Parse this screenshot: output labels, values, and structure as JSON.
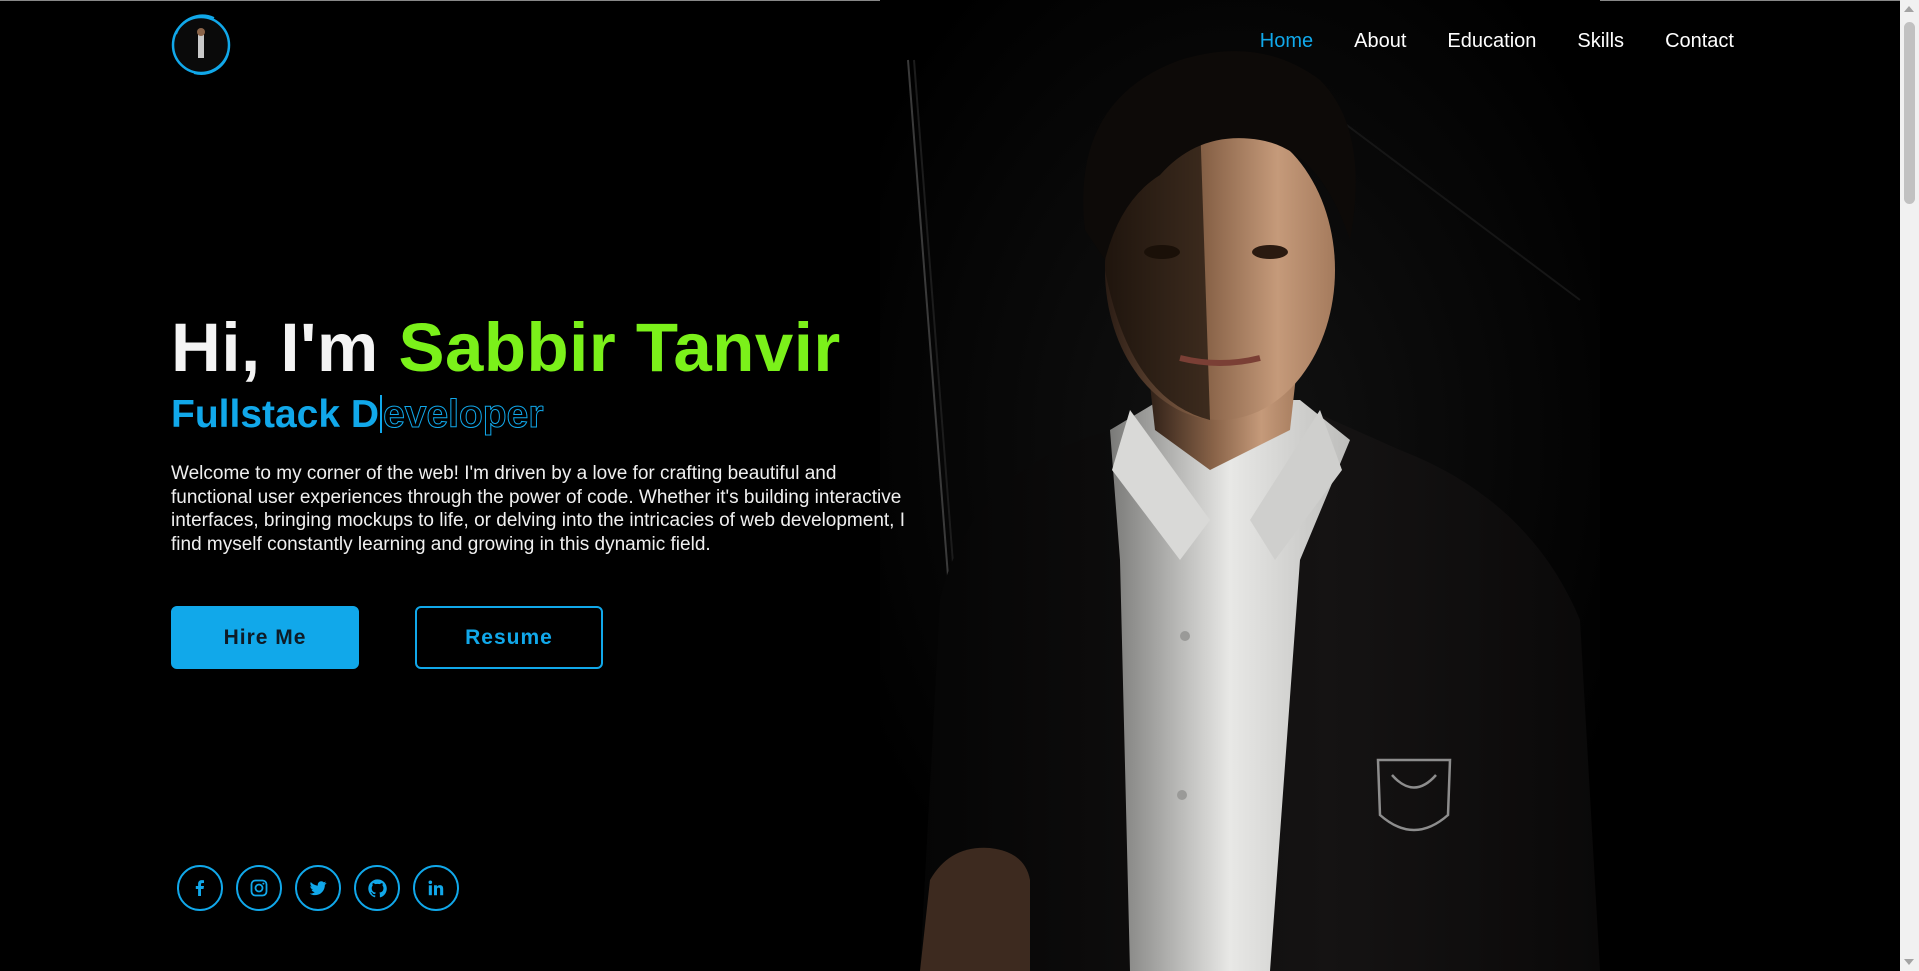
{
  "header": {
    "logo_alt": "Sabbir Tanvir logo",
    "nav": [
      {
        "label": "Home",
        "active": true
      },
      {
        "label": "About",
        "active": false
      },
      {
        "label": "Education",
        "active": false
      },
      {
        "label": "Skills",
        "active": false
      },
      {
        "label": "Contact",
        "active": false
      }
    ]
  },
  "hero": {
    "greeting": "Hi, I'm ",
    "name": "Sabbir Tanvir",
    "role_typed": "Fullstack D",
    "role_ghost": "eveloper",
    "description": "Welcome to my corner of the web! I'm driven by a love for crafting beautiful and functional user experiences through the power of code. Whether it's building interactive interfaces, bringing mockups to life, or delving into the intricacies of web development, I find myself constantly learning and growing in this dynamic field.",
    "hire_button": "Hire Me",
    "resume_button": "Resume"
  },
  "socials": [
    {
      "icon": "facebook-icon"
    },
    {
      "icon": "instagram-icon"
    },
    {
      "icon": "twitter-icon"
    },
    {
      "icon": "github-icon"
    },
    {
      "icon": "linkedin-icon"
    }
  ],
  "colors": {
    "accent": "#11a8ea",
    "name_green": "#7bf11a",
    "background": "#000000"
  }
}
